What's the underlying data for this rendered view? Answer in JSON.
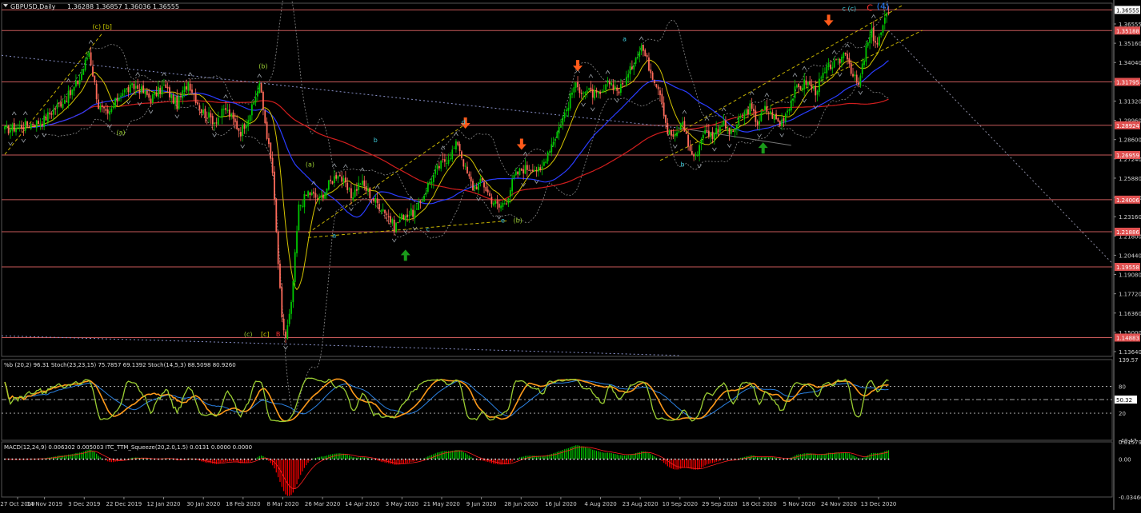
{
  "header": {
    "symbol": "GBPUSD,Daily",
    "ohlc": "1.36288 1.36857 1.36036 1.36555"
  },
  "colors": {
    "bull": "#00c800",
    "bear": "#ff6a5a",
    "hline": "#c85a5a",
    "ma_fast": "#d4c400",
    "ma_mid": "#2a3cff",
    "ma_slow": "#d21e1e",
    "trend": "#8890c8",
    "channel": "#c8b400",
    "stoch_main": "#9acd32",
    "stoch_sig": "#ff9a1a",
    "stoch_slow": "#2a80e0",
    "arrow_down": "#ff5a1a",
    "arrow_up": "#1a9a1a",
    "macd_pos": "#00c800",
    "macd_neg": "#ff0000"
  },
  "chart_data": [
    {
      "type": "candlestick",
      "panel": "main",
      "ylim": [
        1.1364,
        1.37
      ],
      "y_ticks": [
        "1.36555",
        "1.35160",
        "1.34040",
        "1.32680",
        "1.31320",
        "1.29960",
        "1.28600",
        "1.27240",
        "1.25880",
        "1.24520",
        "1.23160",
        "1.21800",
        "1.20440",
        "1.19080",
        "1.17720",
        "1.16360",
        "1.15000",
        "1.13640"
      ],
      "x_ticks": [
        "27 Oct 2019",
        "14 Nov 2019",
        "3 Dec 2019",
        "22 Dec 2019",
        "12 Jan 2020",
        "30 Jan 2020",
        "18 Feb 2020",
        "8 Mar 2020",
        "26 Mar 2020",
        "14 Apr 2020",
        "3 May 2020",
        "21 May 2020",
        "9 Jun 2020",
        "28 Jun 2020",
        "16 Jul 2020",
        "4 Aug 2020",
        "23 Aug 2020",
        "10 Sep 2020",
        "29 Sep 2020",
        "18 Oct 2020",
        "5 Nov 2020",
        "24 Nov 2020",
        "13 Dec 2020"
      ],
      "close_anchors": [
        [
          0,
          1.286
        ],
        [
          10,
          1.289
        ],
        [
          20,
          1.292
        ],
        [
          28,
          1.302
        ],
        [
          35,
          1.31
        ],
        [
          40,
          1.32
        ],
        [
          45,
          1.338
        ],
        [
          50,
          1.302
        ],
        [
          55,
          1.295
        ],
        [
          62,
          1.311
        ],
        [
          70,
          1.315
        ],
        [
          78,
          1.307
        ],
        [
          85,
          1.315
        ],
        [
          92,
          1.303
        ],
        [
          98,
          1.318
        ],
        [
          105,
          1.299
        ],
        [
          112,
          1.292
        ],
        [
          118,
          1.3
        ],
        [
          126,
          1.285
        ],
        [
          132,
          1.3
        ],
        [
          136,
          1.317
        ],
        [
          140,
          1.283
        ],
        [
          143,
          1.258
        ],
        [
          146,
          1.198
        ],
        [
          148,
          1.16
        ],
        [
          150,
          1.149
        ],
        [
          153,
          1.17
        ],
        [
          157,
          1.235
        ],
        [
          162,
          1.245
        ],
        [
          168,
          1.24
        ],
        [
          173,
          1.25
        ],
        [
          178,
          1.258
        ],
        [
          185,
          1.242
        ],
        [
          190,
          1.252
        ],
        [
          197,
          1.24
        ],
        [
          203,
          1.233
        ],
        [
          208,
          1.222
        ],
        [
          213,
          1.23
        ],
        [
          220,
          1.232
        ],
        [
          226,
          1.25
        ],
        [
          232,
          1.262
        ],
        [
          238,
          1.27
        ],
        [
          242,
          1.278
        ],
        [
          246,
          1.26
        ],
        [
          250,
          1.248
        ],
        [
          255,
          1.252
        ],
        [
          260,
          1.24
        ],
        [
          264,
          1.235
        ],
        [
          268,
          1.24
        ],
        [
          272,
          1.255
        ],
        [
          276,
          1.26
        ],
        [
          282,
          1.262
        ],
        [
          286,
          1.258
        ],
        [
          290,
          1.272
        ],
        [
          295,
          1.285
        ],
        [
          300,
          1.3
        ],
        [
          304,
          1.315
        ],
        [
          310,
          1.312
        ],
        [
          318,
          1.308
        ],
        [
          323,
          1.318
        ],
        [
          328,
          1.312
        ],
        [
          333,
          1.322
        ],
        [
          337,
          1.335
        ],
        [
          340,
          1.342
        ],
        [
          345,
          1.325
        ],
        [
          350,
          1.312
        ],
        [
          354,
          1.285
        ],
        [
          358,
          1.281
        ],
        [
          362,
          1.292
        ],
        [
          366,
          1.272
        ],
        [
          369,
          1.268
        ],
        [
          373,
          1.285
        ],
        [
          378,
          1.283
        ],
        [
          383,
          1.291
        ],
        [
          388,
          1.283
        ],
        [
          392,
          1.292
        ],
        [
          398,
          1.301
        ],
        [
          402,
          1.291
        ],
        [
          406,
          1.3
        ],
        [
          410,
          1.296
        ],
        [
          414,
          1.29
        ],
        [
          418,
          1.3
        ],
        [
          422,
          1.312
        ],
        [
          428,
          1.318
        ],
        [
          433,
          1.312
        ],
        [
          437,
          1.322
        ],
        [
          441,
          1.329
        ],
        [
          445,
          1.33
        ],
        [
          449,
          1.339
        ],
        [
          453,
          1.322
        ],
        [
          456,
          1.315
        ],
        [
          460,
          1.34
        ],
        [
          463,
          1.35
        ],
        [
          466,
          1.343
        ],
        [
          469,
          1.354
        ],
        [
          472,
          1.365
        ]
      ],
      "horizontal_levels": [
        "1.36555",
        "1.35188",
        "1.31795",
        "1.28924",
        "1.26959",
        "1.24006",
        "1.21886",
        "1.19558",
        "1.14883"
      ],
      "level_values": [
        1.36555,
        1.35188,
        1.31795,
        1.28924,
        1.26959,
        1.24006,
        1.21886,
        1.19558,
        1.14883
      ],
      "annotations": [
        {
          "text": "(c) [b]",
          "x": 52,
          "y": 1.353
        },
        {
          "text": "(a)",
          "x": 62,
          "y": 1.283
        },
        {
          "text": "(b)",
          "x": 138,
          "y": 1.327
        },
        {
          "text": "(a)",
          "x": 163,
          "y": 1.262
        },
        {
          "text": "a",
          "x": 176,
          "y": 1.215
        },
        {
          "text": "b",
          "x": 198,
          "y": 1.278
        },
        {
          "text": "(c)",
          "x": 130,
          "y": 1.1495
        },
        {
          "text": "[c]",
          "x": 139,
          "y": 1.1495
        },
        {
          "text": "B",
          "x": 146,
          "y": 1.1495
        },
        {
          "text": "c",
          "x": 226,
          "y": 1.219
        },
        {
          "text": "d",
          "x": 245,
          "y": 1.29
        },
        {
          "text": "e",
          "x": 266,
          "y": 1.225
        },
        {
          "text": "(b)",
          "x": 274,
          "y": 1.225
        },
        {
          "text": "a",
          "x": 331,
          "y": 1.345
        },
        {
          "text": "b",
          "x": 362,
          "y": 1.262
        },
        {
          "text": "c (c)",
          "x": 451,
          "y": 1.365
        },
        {
          "text": "C",
          "x": 462,
          "y": 1.365
        },
        {
          "text": "(4)",
          "x": 469,
          "y": 1.366
        }
      ],
      "arrows_down": [
        [
          246,
          1.287
        ],
        [
          306,
          1.325
        ],
        [
          276,
          1.273
        ],
        [
          440,
          1.355
        ]
      ],
      "arrows_up": [
        [
          214,
          1.207
        ],
        [
          405,
          1.278
        ]
      ]
    },
    {
      "type": "line",
      "panel": "oscillator",
      "title": "%b (20,2) 96.31  Stoch(23,23,15) 75.7857 69.1392  Stoch(14,5,3) 88.5098 80.9260",
      "ylim": [
        -40.47,
        139.57
      ],
      "y_ticks": [
        "139.57",
        "80",
        "50.32",
        "20",
        "-40.47"
      ],
      "levels": [
        80,
        50.32,
        20
      ]
    },
    {
      "type": "bar",
      "panel": "macd",
      "title": "MACD(12,24,9) 0.006302 0.005003  ITC_TTM_Squeeze(20,2.0,1.5) 0.0131 0.0000 0.0000",
      "ylim": [
        -0.034665,
        0.015795
      ],
      "y_ticks": [
        "0.015795",
        "0.00",
        "-0.034665"
      ]
    }
  ]
}
